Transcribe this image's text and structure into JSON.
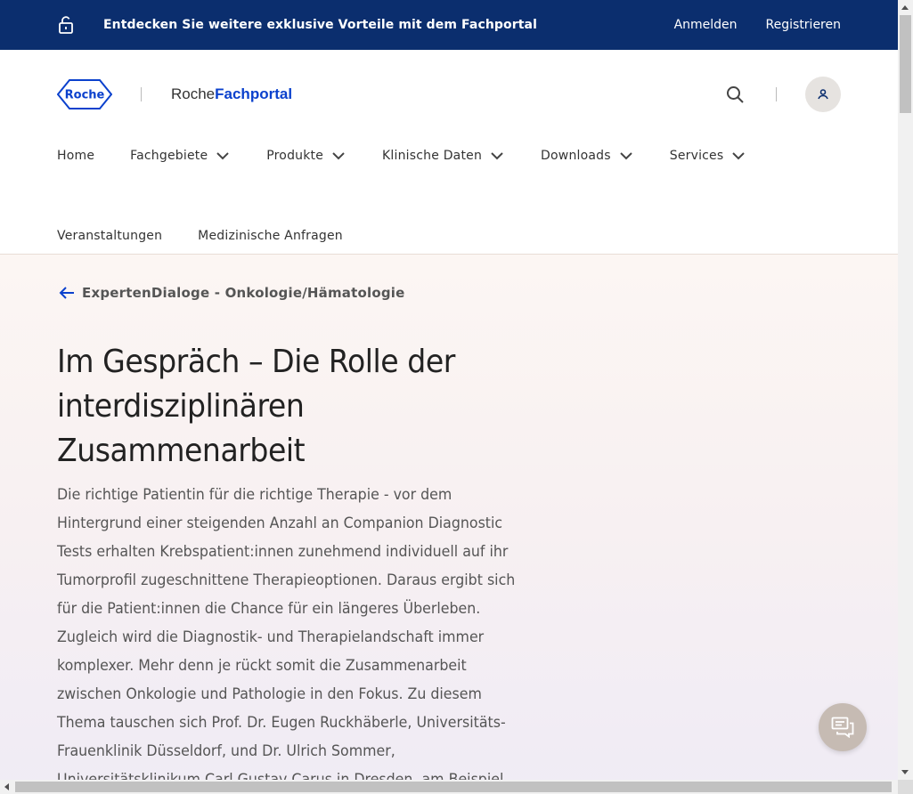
{
  "banner": {
    "message": "Entdecken Sie weitere exklusive Vorteile mit dem Fachportal",
    "login": "Anmelden",
    "register": "Registrieren"
  },
  "header": {
    "logo_text": "Roche",
    "portal_prefix": "Roche",
    "portal_name": "Fachportal"
  },
  "nav": {
    "items": [
      {
        "label": "Home"
      },
      {
        "label": "Fachgebiete"
      },
      {
        "label": "Produkte"
      },
      {
        "label": "Klinische Daten"
      },
      {
        "label": "Downloads"
      },
      {
        "label": "Services"
      },
      {
        "label": "Veranstaltungen"
      },
      {
        "label": "Medizinische Anfragen"
      }
    ]
  },
  "hero": {
    "back_link": "ExpertenDialoge - Onkologie/Hämatologie",
    "title": "Im Gespräch – Die Rolle der interdisziplinären Zusammenarbeit",
    "description": "Die richtige Patientin für die richtige Therapie - vor dem Hintergrund einer steigenden Anzahl an Companion Diagnostic Tests erhalten Krebspatient:innen zunehmend individuell auf ihr Tumorprofil zugeschnittene Therapieoptionen. Daraus ergibt sich für die Patient:innen die Chance für ein längeres Überleben. Zugleich wird die Diagnostik- und Therapielandschaft immer komplexer. Mehr denn je rückt somit die Zusammenarbeit zwischen Onkologie und Pathologie in den Fokus. Zu diesem Thema tauschen sich Prof. Dr. Eugen Ruckhäberle, Universitäts-Frauenklinik Düsseldorf, und Dr. Ulrich Sommer, Universitätsklinikum Carl Gustav Carus in Dresden, am Beispiel"
  },
  "colors": {
    "banner_bg": "#0b2e6e",
    "brand_blue": "#0b41cd",
    "chat_button": "#c6bbb3"
  },
  "icons": [
    "lock-open-icon",
    "roche-logo",
    "search-icon",
    "user-icon",
    "chevron-down-icon",
    "arrow-left-icon",
    "chat-icon"
  ]
}
